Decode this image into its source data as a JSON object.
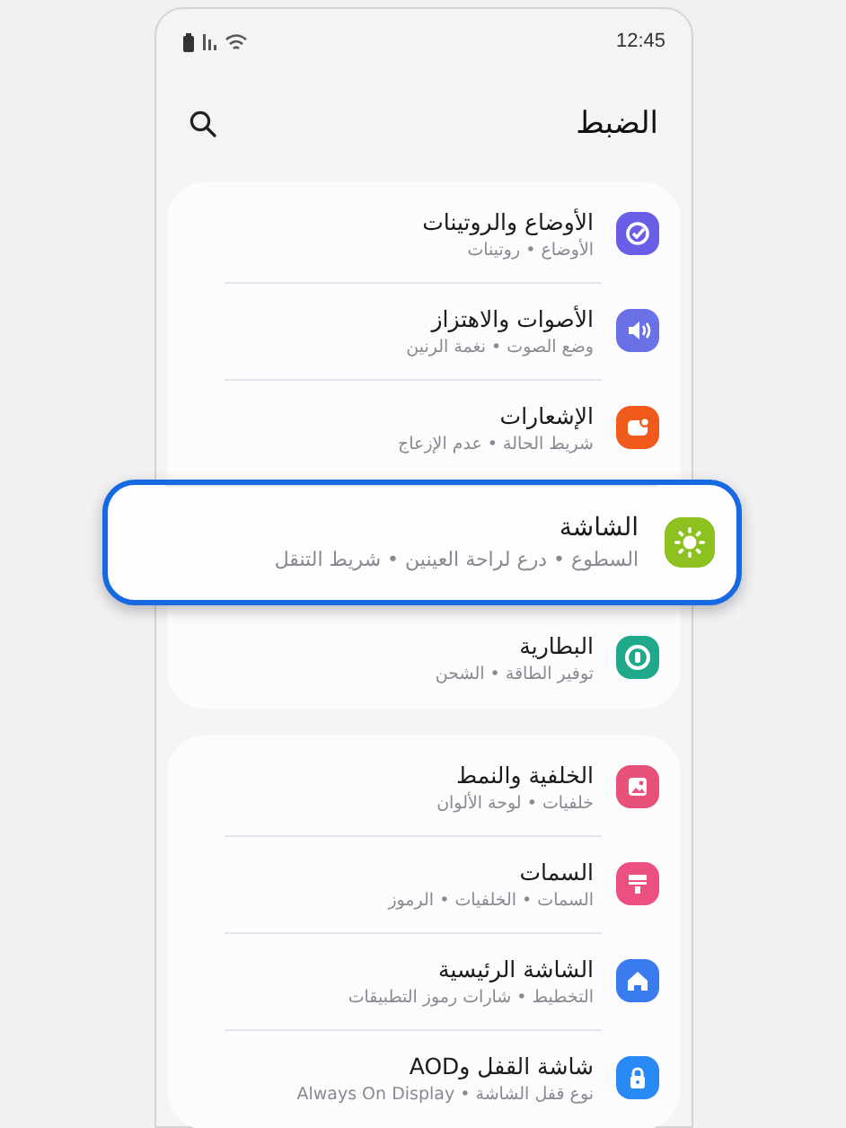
{
  "status_bar": {
    "time": "12:45"
  },
  "header": {
    "title": "الضبط"
  },
  "groups": [
    {
      "items": [
        {
          "title": "الأوضاع والروتينات",
          "subtitle": "الأوضاع • روتينات",
          "kind": "check",
          "color": "#6a5ee8",
          "selected": false
        },
        {
          "title": "الأصوات والاهتزاز",
          "subtitle": "وضع الصوت • نغمة الرنين",
          "kind": "sound",
          "color": "#6a70e6",
          "selected": false
        },
        {
          "title": "الإشعارات",
          "subtitle": "شريط الحالة • عدم الإزعاج",
          "kind": "notify",
          "color": "#f05a1a",
          "selected": false
        },
        {
          "title": "الشاشة",
          "subtitle": "السطوع • درع لراحة العينين • شريط التنقل",
          "kind": "sun",
          "color": "#8cc11f",
          "selected": true
        },
        {
          "title": "البطارية",
          "subtitle": "توفير الطاقة • الشحن",
          "kind": "battery",
          "color": "#1fa98a",
          "selected": false
        }
      ]
    },
    {
      "items": [
        {
          "title": "الخلفية والنمط",
          "subtitle": "خلفيات • لوحة الألوان",
          "kind": "image",
          "color": "#e8527a",
          "selected": false
        },
        {
          "title": "السمات",
          "subtitle": "السمات • الخلفيات • الرموز",
          "kind": "brush",
          "color": "#ec5080",
          "selected": false
        },
        {
          "title": "الشاشة الرئيسية",
          "subtitle": "التخطيط • شارات رموز التطبيقات",
          "kind": "home",
          "color": "#3a7bf0",
          "selected": false
        },
        {
          "title": "شاشة القفل وAOD",
          "subtitle": "نوع قفل الشاشة • Always On Display",
          "kind": "lock",
          "color": "#2a8af5",
          "selected": false
        }
      ]
    }
  ]
}
